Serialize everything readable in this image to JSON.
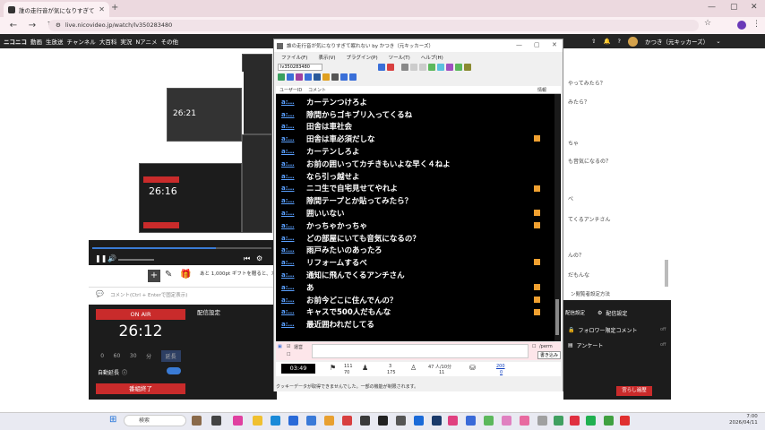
{
  "browser": {
    "tab_title": "誰の走行音が気になりすぎて困れない…",
    "url": "live.nicovideo.jp/watch/lv350283480",
    "window_controls": [
      "—",
      "▢",
      "✕"
    ]
  },
  "site_nav": {
    "items": [
      "ニコニコ",
      "動画",
      "生放送",
      "チャンネル",
      "大百科",
      "実況",
      "Nアニメ",
      "その他"
    ],
    "user_name": "かつき（元キッカーズ）"
  },
  "right_panel": {
    "comments": [
      "やってみたら？",
      "みたら？",
      "ちゃ",
      "も音気になるの？",
      "べ",
      "てくるアンチさん",
      "んの？",
      "だもんな"
    ],
    "visit_label": "ン閲覧者設定方法",
    "dark_items": [
      {
        "label": "配信設定",
        "state": ""
      },
      {
        "label": "フォロワー限定コメント",
        "state": "off"
      },
      {
        "label": "アンケート",
        "state": "off"
      }
    ],
    "gifts_btn": "宮らし遍歴",
    "haishin_label": "配信設定"
  },
  "live_control": {
    "on_air": "ON AIR",
    "timer": "26:12",
    "durations": [
      "0",
      "60",
      "30",
      "分",
      "延長"
    ],
    "auto_extend": "自動延長",
    "end_button": "番組終了",
    "settings_label": "配信設定",
    "gift_text": "あと 1,000pt ギフトを贈ると、ガ",
    "comment_placeholder": "コメント(Ctrl + Enterで固定表示)",
    "mini_timer": "26:21",
    "mini_timer2": "26:16"
  },
  "app": {
    "title": "誰の走行音が気になりすぎて眠れない by かつき（元キッカーズ）",
    "menu": [
      "ファイル(F)",
      "表示(V)",
      "プラグイン(P)",
      "ツール(T)",
      "ヘルプ(H)"
    ],
    "lv_id": "lv350283480",
    "col_user": "ユーザーID",
    "col_comment": "コメント",
    "col_info": "情報",
    "comments": [
      {
        "user": "a:…",
        "text": "カーテンつけろよ",
        "flag": false
      },
      {
        "user": "a:…",
        "text": "隙間からゴキブリ入ってくるね",
        "flag": false
      },
      {
        "user": "a:…",
        "text": "田舎は車社会",
        "flag": false
      },
      {
        "user": "a:…",
        "text": "田舎は車必須だしな",
        "flag": true
      },
      {
        "user": "a:…",
        "text": "カーテンしろよ",
        "flag": false
      },
      {
        "user": "a:…",
        "text": "お前の囲いってカチきもいよな早く４ねよ",
        "flag": false
      },
      {
        "user": "a:…",
        "text": "なら引っ越せよ",
        "flag": false
      },
      {
        "user": "a:…",
        "text": "ニコ生で自宅見せてやれよ",
        "flag": true
      },
      {
        "user": "a:…",
        "text": "隙間テープとか貼ってみたら？",
        "flag": false
      },
      {
        "user": "a:…",
        "text": "囲いいない",
        "flag": true
      },
      {
        "user": "a:…",
        "text": "かっちゃかっちゃ",
        "flag": true
      },
      {
        "user": "a:…",
        "text": "どの部屋にいても音気になるの？",
        "flag": false
      },
      {
        "user": "a:…",
        "text": "雨戸みたいのあったろ",
        "flag": false
      },
      {
        "user": "a:…",
        "text": "リフォームするべ",
        "flag": true
      },
      {
        "user": "a:…",
        "text": "通知に飛んでくるアンチさん",
        "flag": false
      },
      {
        "user": "a:…",
        "text": "あ",
        "flag": true
      },
      {
        "user": "a:…",
        "text": "お前今どこに住んでんの？",
        "flag": true
      },
      {
        "user": "a:…",
        "text": "キャスで500人だもんな",
        "flag": true
      },
      {
        "user": "a:…",
        "text": "最近囲われだしてる",
        "flag": false
      }
    ],
    "input_label1": "運営",
    "perm_label": "/perm",
    "write_button": "書き込み",
    "elapsed": "03:49",
    "stat_a_top": "111",
    "stat_a_bot": "70",
    "stat_b_top": "3",
    "stat_b_bot": "175",
    "stat_c_top": "47 人/10分",
    "stat_c_bot": "11",
    "stat_d_top": "200",
    "stat_d_bot": "0",
    "status": "クッキーデータが取得できませんでした。一部の機能が制限されます。"
  },
  "taskbar": {
    "search": "検索",
    "time": "7:00",
    "date": "2026/04/11"
  }
}
